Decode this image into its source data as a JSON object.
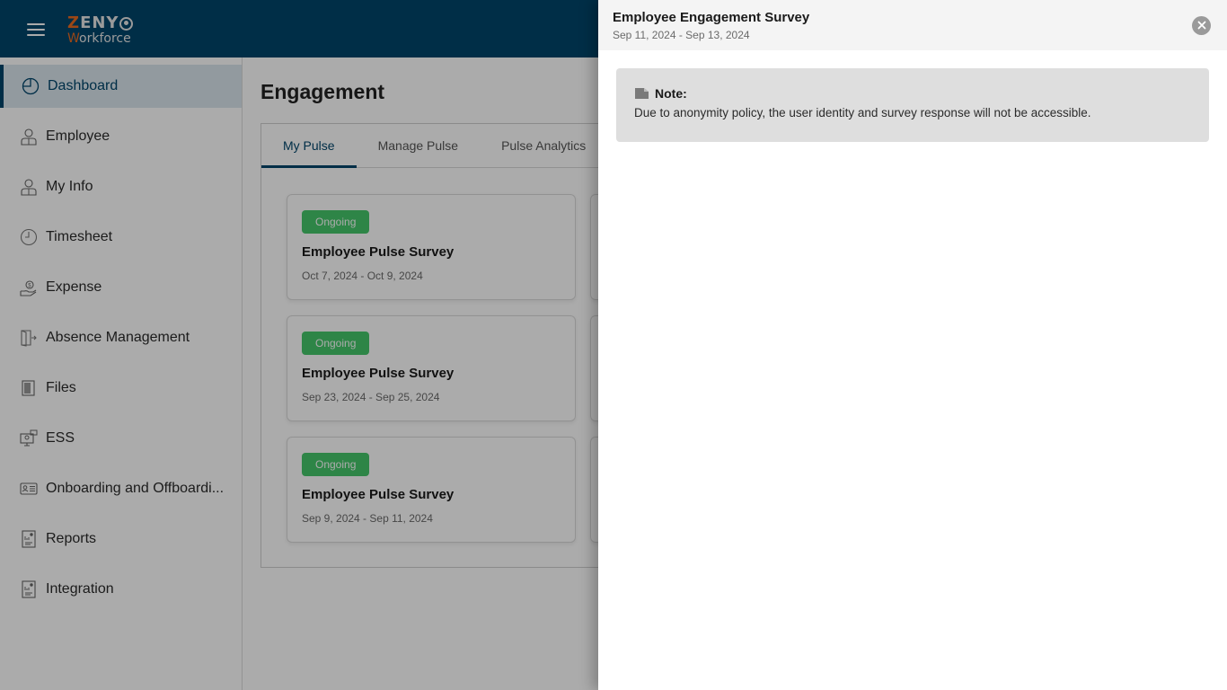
{
  "app": {
    "logo_top": "ZENY",
    "logo_top_accent": "Z",
    "logo_bottom": "Workforce",
    "logo_bottom_accent": "W",
    "brand_color": "#00456b",
    "accent_color": "#e86a20"
  },
  "sidebar": {
    "items": [
      {
        "label": "Dashboard",
        "icon": "pie-chart-icon",
        "active": true
      },
      {
        "label": "Employee",
        "icon": "employee-icon"
      },
      {
        "label": "My Info",
        "icon": "user-info-icon"
      },
      {
        "label": "Timesheet",
        "icon": "clock-icon"
      },
      {
        "label": "Expense",
        "icon": "money-hand-icon"
      },
      {
        "label": "Absence Management",
        "icon": "door-exit-icon"
      },
      {
        "label": "Files",
        "icon": "files-icon"
      },
      {
        "label": "ESS",
        "icon": "self-service-monitor-icon"
      },
      {
        "label": "Onboarding and Offboardi...",
        "icon": "id-card-icon"
      },
      {
        "label": "Reports",
        "icon": "report-icon"
      },
      {
        "label": "Integration",
        "icon": "integration-icon"
      }
    ]
  },
  "main": {
    "title": "Engagement",
    "tabs": [
      {
        "label": "My Pulse",
        "active": true
      },
      {
        "label": "Manage Pulse"
      },
      {
        "label": "Pulse Analytics"
      }
    ],
    "cards": [
      {
        "status": "Ongoing",
        "title": "Employee Pulse Survey",
        "dates": "Oct 7, 2024 - Oct 9, 2024"
      },
      {
        "status": "",
        "title": "",
        "dates": ""
      },
      {
        "status": "",
        "title": "",
        "dates": ""
      },
      {
        "status": "Ongoing",
        "title": "Employee Pulse Survey",
        "dates": "Sep 23, 2024 - Sep 25, 2024"
      },
      {
        "status": "",
        "title": "",
        "dates": ""
      },
      {
        "status": "",
        "title": "",
        "dates": ""
      },
      {
        "status": "Ongoing",
        "title": "Employee Pulse Survey",
        "dates": "Sep 9, 2024 - Sep 11, 2024"
      },
      {
        "status": "",
        "title": "",
        "dates": ""
      },
      {
        "status": "",
        "title": "",
        "dates": ""
      }
    ],
    "status_color": "#45c76b"
  },
  "drawer": {
    "title": "Employee Engagement Survey",
    "dates": "Sep 11, 2024 - Sep 13, 2024",
    "close_icon": "close-circle-icon",
    "note": {
      "heading": "Note:",
      "text": "Due to anonymity policy, the user identity and survey response will not be accessible."
    }
  }
}
